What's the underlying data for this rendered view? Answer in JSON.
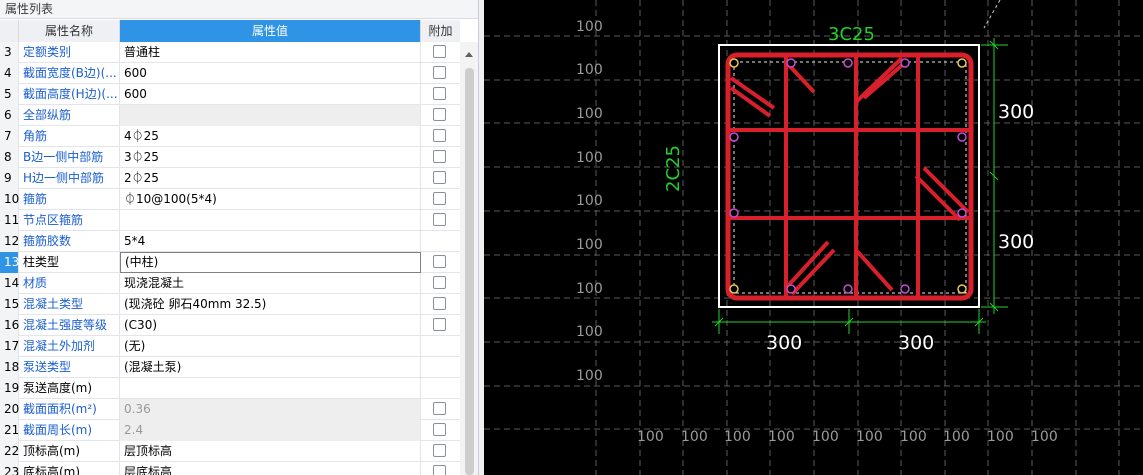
{
  "panel": {
    "title": "属性列表",
    "headers": {
      "name": "属性名称",
      "value": "属性值",
      "attach": "附加"
    }
  },
  "rows": [
    {
      "num": "3",
      "name": "定额类别",
      "value": "普通柱",
      "blue": true,
      "checkbox": true,
      "gray": false
    },
    {
      "num": "4",
      "name": "截面宽度(B边)(...",
      "value": "600",
      "blue": true,
      "checkbox": true,
      "gray": false
    },
    {
      "num": "5",
      "name": "截面高度(H边)(...",
      "value": "600",
      "blue": true,
      "checkbox": true,
      "gray": false
    },
    {
      "num": "6",
      "name": "全部纵筋",
      "value": "",
      "blue": true,
      "checkbox": true,
      "gray": true
    },
    {
      "num": "7",
      "name": "角筋",
      "value": "4⏀25",
      "blue": true,
      "checkbox": true,
      "gray": false
    },
    {
      "num": "8",
      "name": "B边一侧中部筋",
      "value": "3⏀25",
      "blue": true,
      "checkbox": true,
      "gray": false
    },
    {
      "num": "9",
      "name": "H边一侧中部筋",
      "value": "2⏀25",
      "blue": true,
      "checkbox": true,
      "gray": false
    },
    {
      "num": "10",
      "name": "箍筋",
      "value": "⏀10@100(5*4)",
      "blue": true,
      "checkbox": true,
      "gray": false
    },
    {
      "num": "11",
      "name": "节点区箍筋",
      "value": "",
      "blue": true,
      "checkbox": true,
      "gray": false
    },
    {
      "num": "12",
      "name": "箍筋胶数",
      "value": "5*4",
      "blue": true,
      "checkbox": false,
      "gray": false
    },
    {
      "num": "13",
      "name": "柱类型",
      "value": "(中柱)",
      "blue": false,
      "checkbox": true,
      "gray": false,
      "editing": true,
      "highlight": true
    },
    {
      "num": "14",
      "name": "材质",
      "value": "现浇混凝土",
      "blue": true,
      "checkbox": true,
      "gray": false
    },
    {
      "num": "15",
      "name": "混凝土类型",
      "value": "(现浇砼 卵石40mm 32.5)",
      "blue": true,
      "checkbox": true,
      "gray": false
    },
    {
      "num": "16",
      "name": "混凝土强度等级",
      "value": "(C30)",
      "blue": true,
      "checkbox": true,
      "gray": false
    },
    {
      "num": "17",
      "name": "混凝土外加剂",
      "value": "(无)",
      "blue": true,
      "checkbox": false,
      "gray": false
    },
    {
      "num": "18",
      "name": "泵送类型",
      "value": "(混凝土泵)",
      "blue": true,
      "checkbox": false,
      "gray": false
    },
    {
      "num": "19",
      "name": "泵送高度(m)",
      "value": "",
      "blue": false,
      "checkbox": false,
      "gray": false
    },
    {
      "num": "20",
      "name": "截面面积(m²)",
      "value": "0.36",
      "blue": true,
      "checkbox": true,
      "gray": true
    },
    {
      "num": "21",
      "name": "截面周长(m)",
      "value": "2.4",
      "blue": true,
      "checkbox": true,
      "gray": true
    },
    {
      "num": "22",
      "name": "顶标高(m)",
      "value": "层顶标高",
      "blue": false,
      "checkbox": true,
      "gray": false
    },
    {
      "num": "23",
      "name": "底标高(m)",
      "value": "层底标高",
      "blue": false,
      "checkbox": true,
      "gray": false
    }
  ],
  "cad": {
    "grid_label": "100",
    "top_rebar_label": "3C25",
    "side_rebar_label": "2C25",
    "dim_top": "300",
    "dim_right_bottom": "300",
    "dim_bottom_left": "300",
    "dim_bottom_right": "300",
    "colors": {
      "rebar": "#d8202c",
      "dim": "#22d12a",
      "outline": "#ffffff",
      "grid": "#5a5a5a"
    }
  }
}
